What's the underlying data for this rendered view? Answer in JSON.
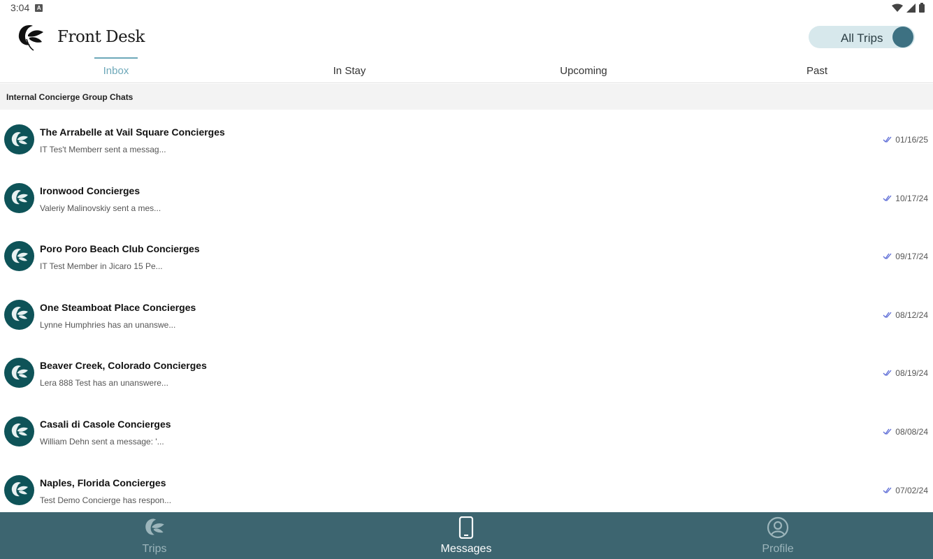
{
  "status_bar": {
    "time": "3:04",
    "notification_icon": "a-notification-icon",
    "icons": [
      "wifi-icon",
      "signal-icon",
      "battery-icon"
    ]
  },
  "header": {
    "brand": "Front Desk",
    "logo_icon": "leaf-logo-icon",
    "toggle_label": "All Trips"
  },
  "tabs": [
    {
      "label": "Inbox",
      "active": true
    },
    {
      "label": "In Stay",
      "active": false
    },
    {
      "label": "Upcoming",
      "active": false
    },
    {
      "label": "Past",
      "active": false
    }
  ],
  "section": {
    "title": "Internal Concierge Group Chats"
  },
  "chats": [
    {
      "title": "The Arrabelle at Vail Square Concierges",
      "preview": "IT Tes't Memberr sent a messag...",
      "date": "01/16/25"
    },
    {
      "title": "Ironwood Concierges",
      "preview": "Valeriy Malinovskiy sent a mes...",
      "date": "10/17/24"
    },
    {
      "title": "Poro Poro Beach Club Concierges",
      "preview": "IT Test Member in Jicaro 15 Pe...",
      "date": "09/17/24"
    },
    {
      "title": "One Steamboat Place Concierges",
      "preview": "Lynne Humphries has an unanswe...",
      "date": "08/12/24"
    },
    {
      "title": "Beaver Creek, Colorado Concierges",
      "preview": "Lera 888 Test has an unanswere...",
      "date": "08/19/24"
    },
    {
      "title": "Casali di Casole Concierges",
      "preview": "William Dehn sent a message: '...",
      "date": "08/08/24"
    },
    {
      "title": "Naples, Florida Concierges",
      "preview": "Test Demo Concierge has respon...",
      "date": "07/02/24"
    }
  ],
  "bottom_nav": [
    {
      "label": "Trips",
      "icon": "leaf-icon",
      "active": false
    },
    {
      "label": "Messages",
      "icon": "phone-icon",
      "active": true
    },
    {
      "label": "Profile",
      "icon": "profile-icon",
      "active": false
    }
  ],
  "colors": {
    "accent": "#6da8b9",
    "avatar": "#0e5358",
    "nav_bar": "#3d6570",
    "toggle_track": "#d7e8ec",
    "toggle_knob": "#3d7182",
    "read_check": "#5b6bd6"
  }
}
